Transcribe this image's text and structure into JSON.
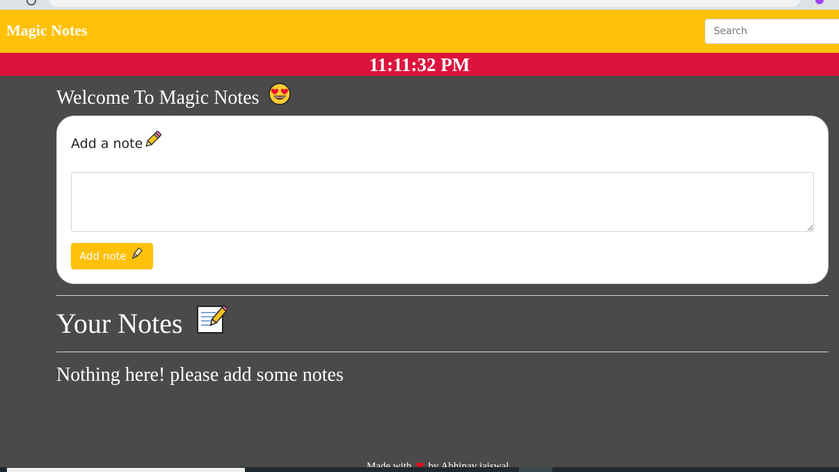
{
  "navbar": {
    "brand": "Magic Notes",
    "search_placeholder": "Search",
    "color": "#ffc107"
  },
  "clock": {
    "time": "11:11:32 PM",
    "color": "#dc143c"
  },
  "welcome": {
    "text": "Welcome To Magic Notes",
    "emoji_icon": "heart-eyes-face-icon"
  },
  "add_card": {
    "title": "Add a note",
    "title_icon": "pencil-icon",
    "textarea_value": "",
    "button_label": "Add note",
    "button_icon": "pen-icon"
  },
  "notes_section": {
    "heading": "Your Notes",
    "heading_icon": "memo-icon",
    "empty_message": "Nothing here! please add some notes"
  },
  "footer": {
    "made_with": "Made with",
    "heart_icon": "heart-icon",
    "by": "by Abhinav jaiswal"
  }
}
